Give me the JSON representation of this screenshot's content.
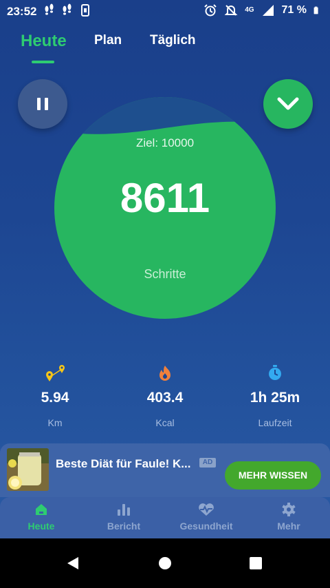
{
  "status_bar": {
    "time": "23:52",
    "network": "4G",
    "battery": "71 %",
    "icons": [
      "steps-notification-icon",
      "steps-notification-icon",
      "phone-icon",
      "alarm-icon",
      "notifications-off-icon",
      "signal-icon",
      "battery-icon"
    ]
  },
  "tabs": [
    {
      "label": "Heute",
      "active": true
    },
    {
      "label": "Plan",
      "active": false
    },
    {
      "label": "Täglich",
      "active": false
    }
  ],
  "controls": {
    "pause_icon": "pause-icon",
    "expand_icon": "chevron-down-icon"
  },
  "progress": {
    "goal_label": "Ziel: 10000",
    "steps": "8611",
    "steps_label": "Schritte",
    "fill_fraction": 0.8611
  },
  "stats": [
    {
      "icon": "route-icon",
      "value": "5.94",
      "label": "Km"
    },
    {
      "icon": "flame-icon",
      "value": "403.4",
      "label": "Kcal"
    },
    {
      "icon": "stopwatch-icon",
      "value": "1h 25m",
      "label": "Laufzeit"
    }
  ],
  "ad": {
    "title": "Beste Diät für Faule! K...",
    "badge": "AD",
    "cta": "MEHR WISSEN"
  },
  "bottom_nav": [
    {
      "icon": "home-icon",
      "label": "Heute",
      "active": true
    },
    {
      "icon": "bar-chart-icon",
      "label": "Bericht",
      "active": false
    },
    {
      "icon": "heart-pulse-icon",
      "label": "Gesundheit",
      "active": false
    },
    {
      "icon": "gear-icon",
      "label": "Mehr",
      "active": false
    }
  ],
  "colors": {
    "accent_green": "#2ecc71",
    "circle_green": "#27b660",
    "background_blue": "#1d4692",
    "cta_green": "#43a82c"
  }
}
